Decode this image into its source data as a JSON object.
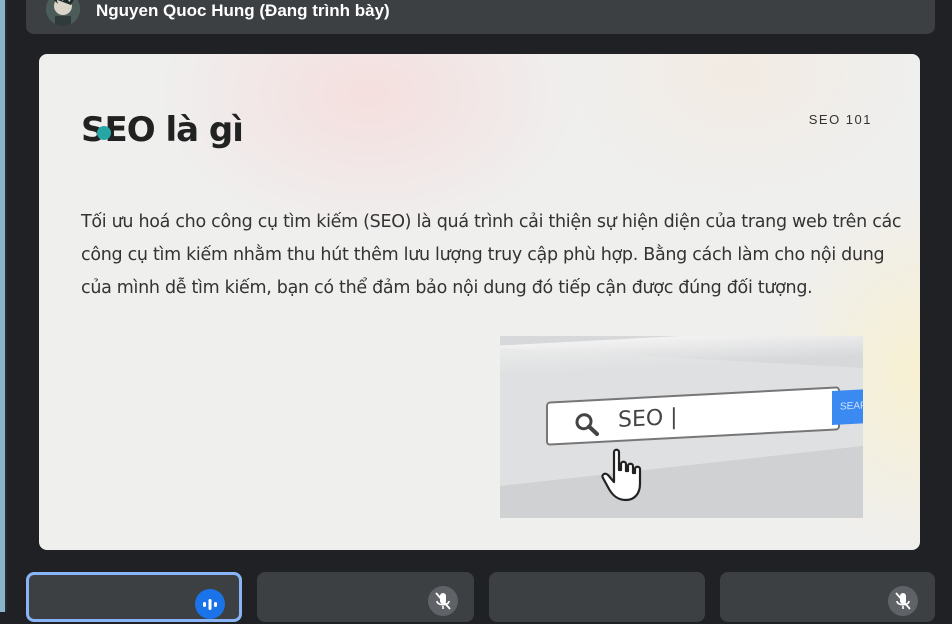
{
  "presenter": {
    "name": "Nguyen Quoc Hung (Đang trình bày)"
  },
  "slide": {
    "title": "SEO là gì",
    "tag": "SEO 101",
    "body": "Tối ưu hoá cho công cụ tìm kiếm (SEO) là quá trình cải thiện sự hiện diện của trang web trên các công cụ tìm kiếm nhằm thu hút thêm lưu lượng truy cập phù hợp. Bằng cách làm cho nội dung của mình dễ tìm kiếm, bạn có thể đảm bảo nội dung đó tiếp cận được đúng đối tượng.",
    "image": {
      "search_text": "SEO |",
      "button_text": "SEAR"
    }
  },
  "tiles": [
    {
      "state": "speaking",
      "icon": "speaking-icon"
    },
    {
      "state": "muted",
      "icon": "mic-off-icon"
    },
    {
      "state": "none"
    },
    {
      "state": "muted",
      "icon": "mic-off-icon"
    }
  ],
  "colors": {
    "background": "#202124",
    "tile": "#3c4043",
    "accent": "#8ab4f8",
    "speaking": "#1a73e8",
    "slide_dot": "#27a6a6"
  }
}
